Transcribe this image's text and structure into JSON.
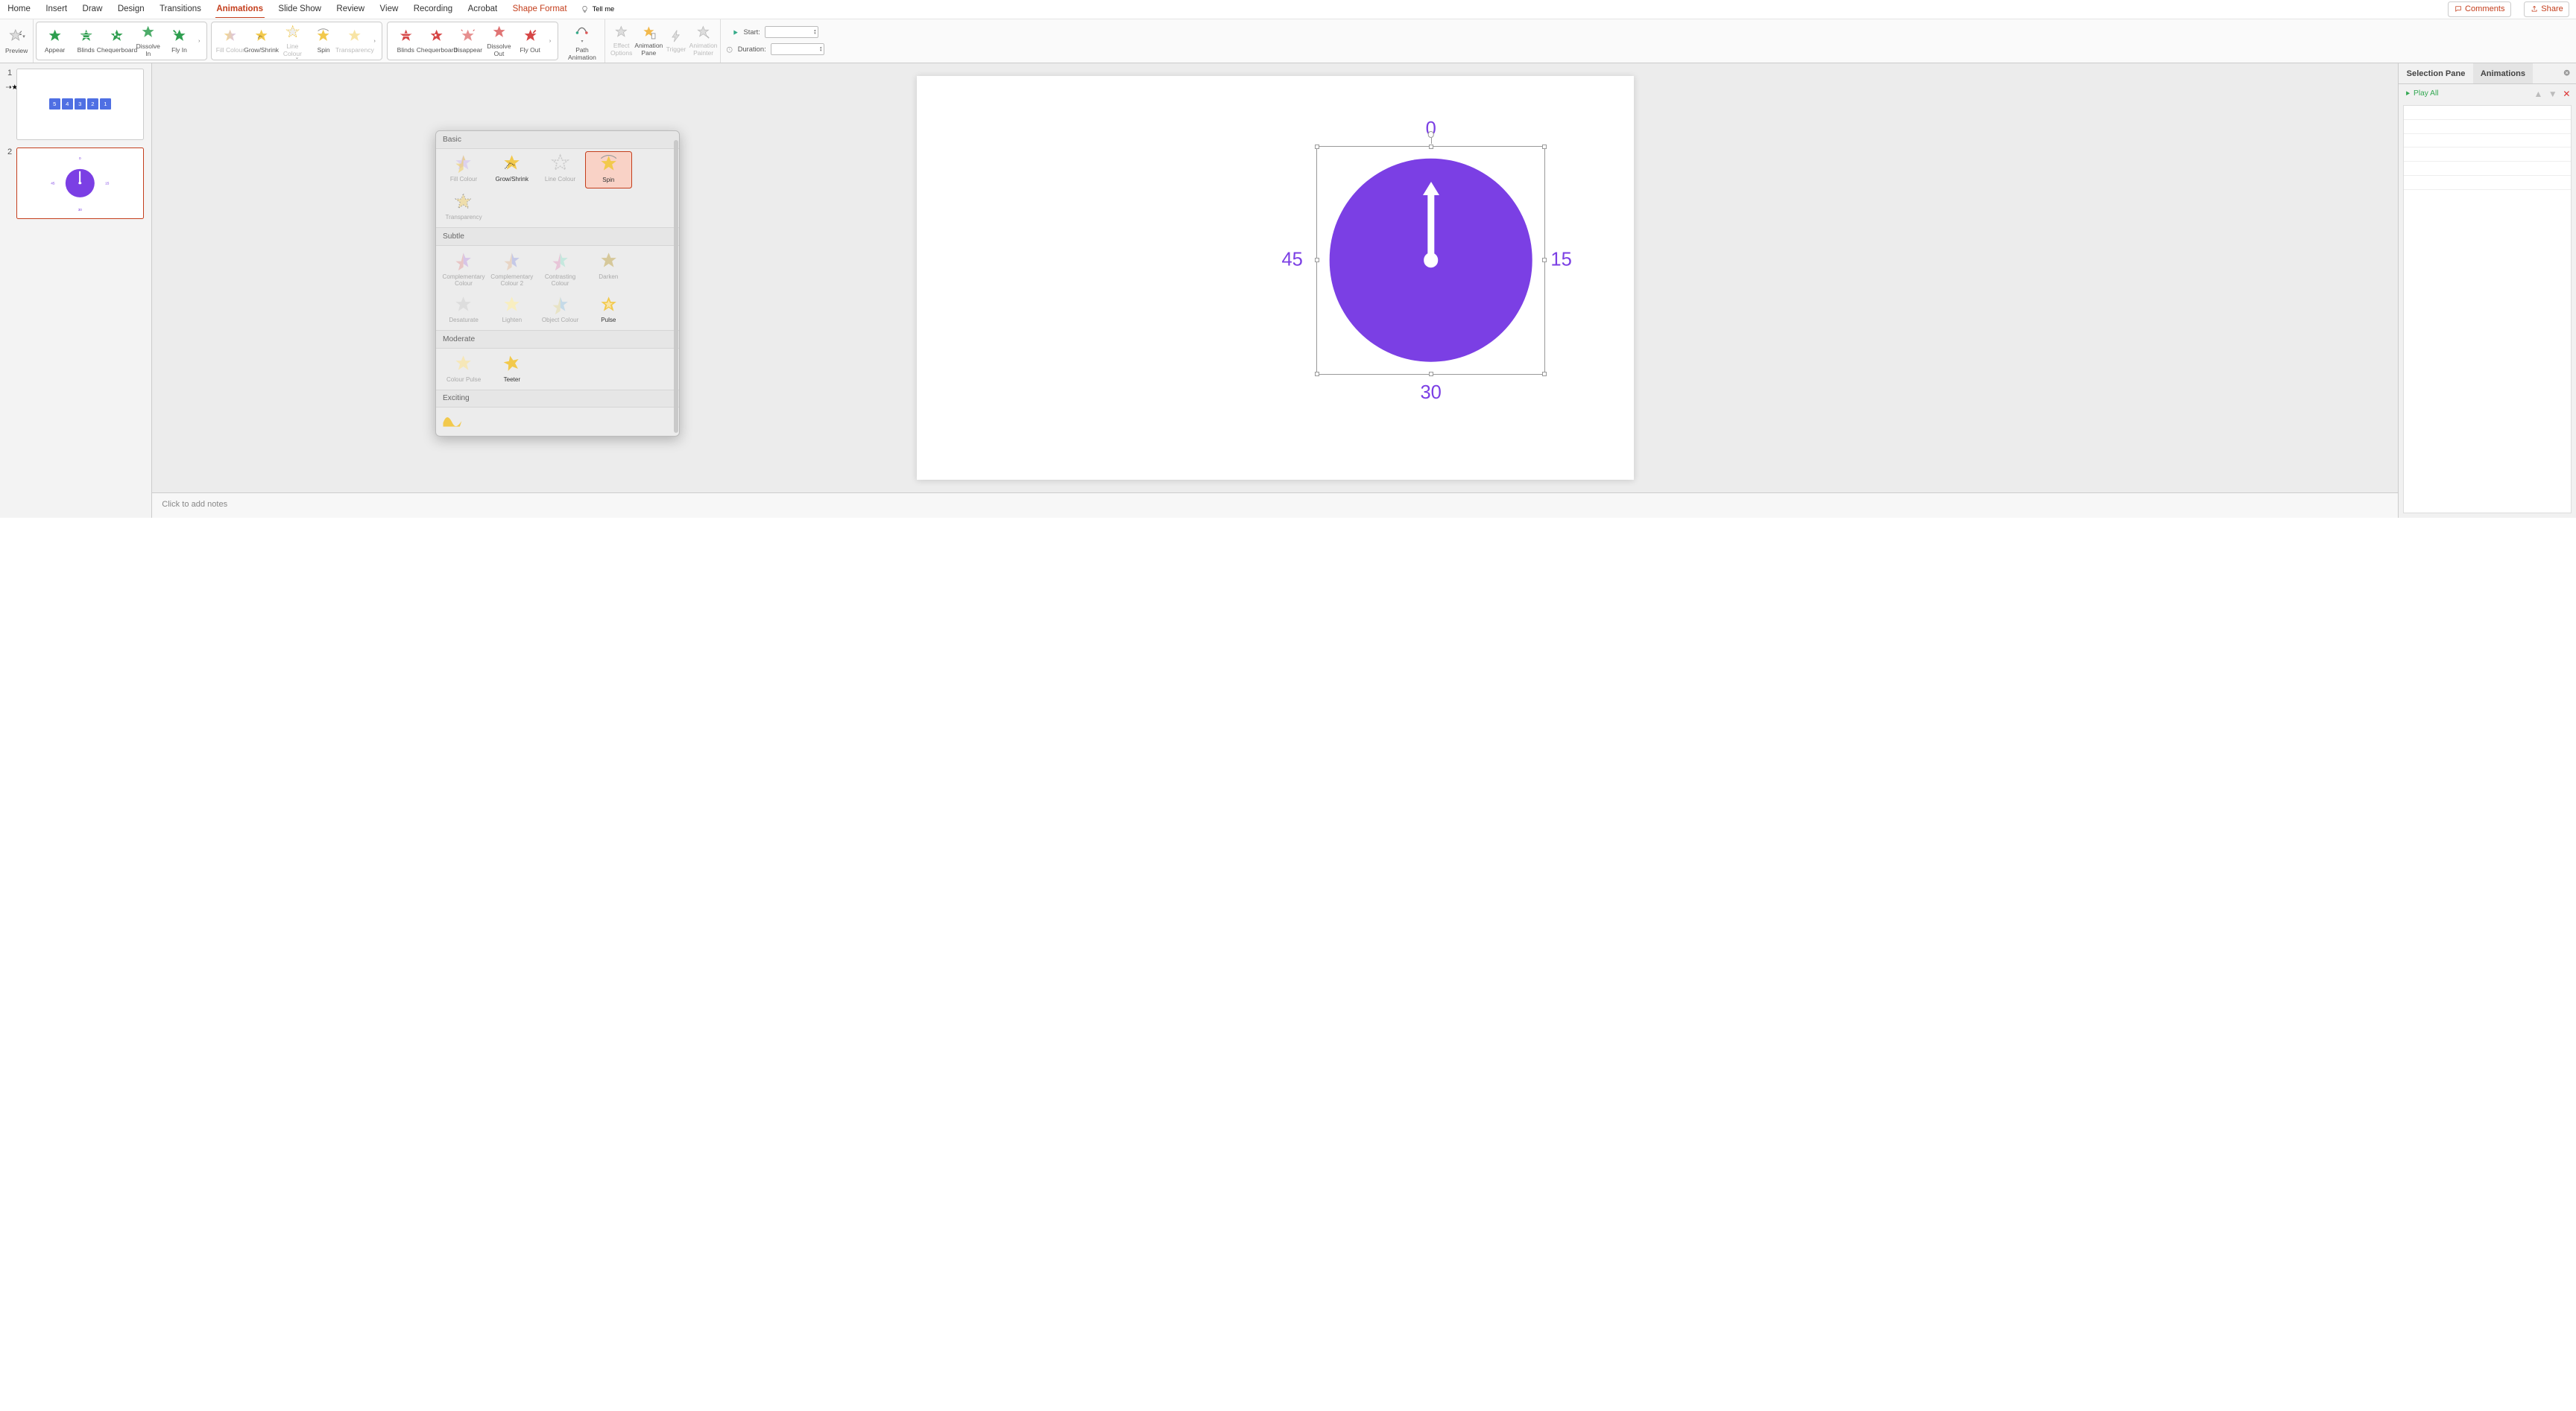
{
  "menu": {
    "home": "Home",
    "insert": "Insert",
    "draw": "Draw",
    "design": "Design",
    "transitions": "Transitions",
    "animations": "Animations",
    "slideshow": "Slide Show",
    "review": "Review",
    "view": "View",
    "recording": "Recording",
    "acrobat": "Acrobat",
    "shapeformat": "Shape Format",
    "tellme": "Tell me",
    "comments": "Comments",
    "share": "Share"
  },
  "ribbon": {
    "preview": "Preview",
    "entrance": [
      "Appear",
      "Blinds",
      "Chequerboard",
      "Dissolve In",
      "Fly In"
    ],
    "emphasis": [
      "Fill Colour",
      "Grow/Shrink",
      "Line Colour",
      "Spin",
      "Transparency"
    ],
    "exit": [
      "Blinds",
      "Chequerboard",
      "Disappear",
      "Dissolve Out",
      "Fly Out"
    ],
    "path": "Path Animation",
    "effect": "Effect Options",
    "pane": "Animation Pane",
    "trigger": "Trigger",
    "painter": "Animation Painter",
    "start": "Start:",
    "duration": "Duration:"
  },
  "gallery": {
    "basic": "Basic",
    "basic_items": [
      "Fill Colour",
      "Grow/Shrink",
      "Line Colour",
      "Spin",
      "Transparency"
    ],
    "subtle": "Subtle",
    "subtle_items": [
      "Complementary Colour",
      "Complementary Colour 2",
      "Contrasting Colour",
      "Darken",
      "Desaturate",
      "Lighten",
      "Object Colour",
      "Pulse"
    ],
    "moderate": "Moderate",
    "moderate_items": [
      "Colour Pulse",
      "Teeter"
    ],
    "exciting": "Exciting"
  },
  "thumbs": {
    "s1": [
      "5",
      "4",
      "3",
      "2",
      "1"
    ],
    "s2": {
      "n0": "0",
      "n15": "15",
      "n30": "30",
      "n45": "45"
    },
    "num1": "1",
    "num2": "2"
  },
  "slide": {
    "l0": "0",
    "l15": "15",
    "l30": "30",
    "l45": "45"
  },
  "notes": "Click to add notes",
  "panes": {
    "selection": "Selection Pane",
    "animations": "Animations",
    "playall": "Play All"
  }
}
